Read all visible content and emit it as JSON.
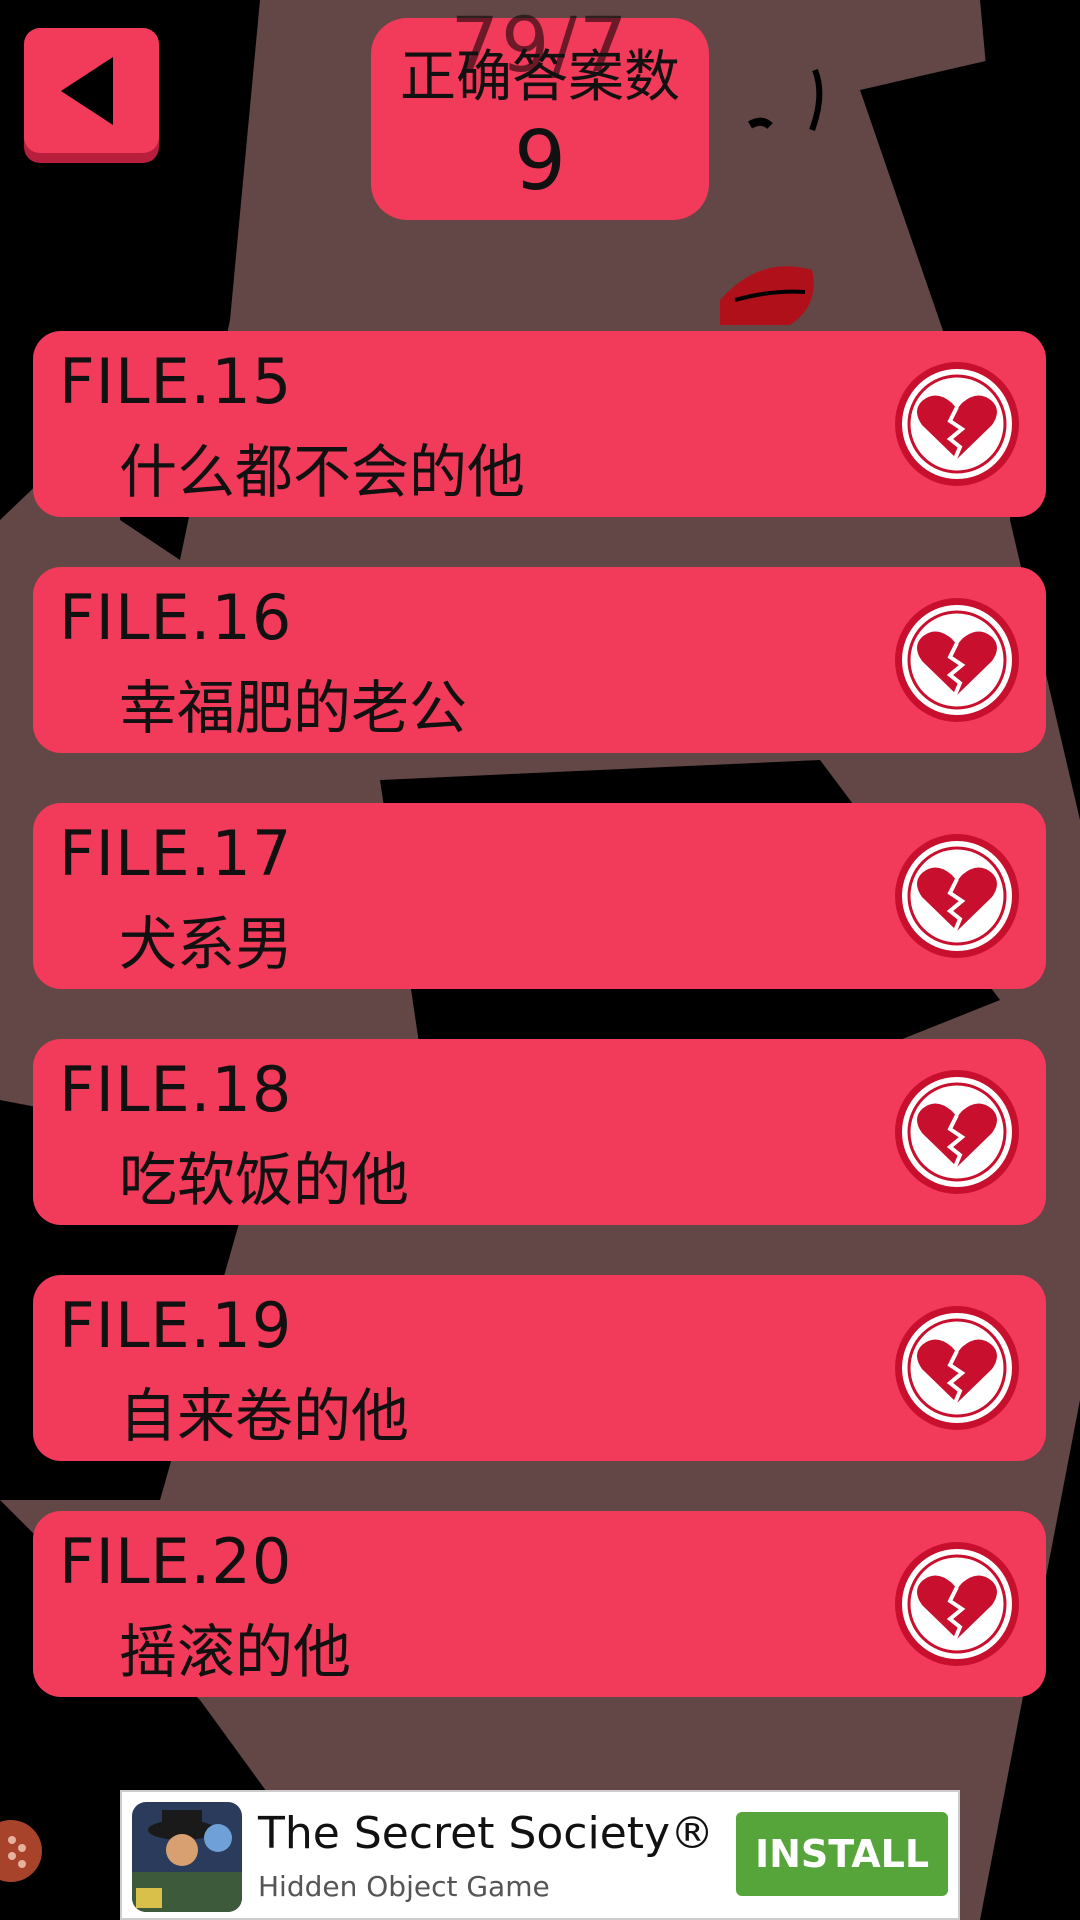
{
  "score": {
    "title": "正确答案数",
    "overlay_text": "79/7",
    "value": "9"
  },
  "files": [
    {
      "code": "FILE.15",
      "title": "什么都不会的他"
    },
    {
      "code": "FILE.16",
      "title": "幸福肥的老公"
    },
    {
      "code": "FILE.17",
      "title": "犬系男"
    },
    {
      "code": "FILE.18",
      "title": "吃软饭的他"
    },
    {
      "code": "FILE.19",
      "title": "自来卷的他"
    },
    {
      "code": "FILE.20",
      "title": "摇滚的他"
    }
  ],
  "ad": {
    "title": "The Secret Society®",
    "subtitle": "Hidden Object Game",
    "install_label": "INSTALL"
  },
  "colors": {
    "accent": "#f23a5a",
    "heart": "#c8102e",
    "install": "#55a53a"
  }
}
